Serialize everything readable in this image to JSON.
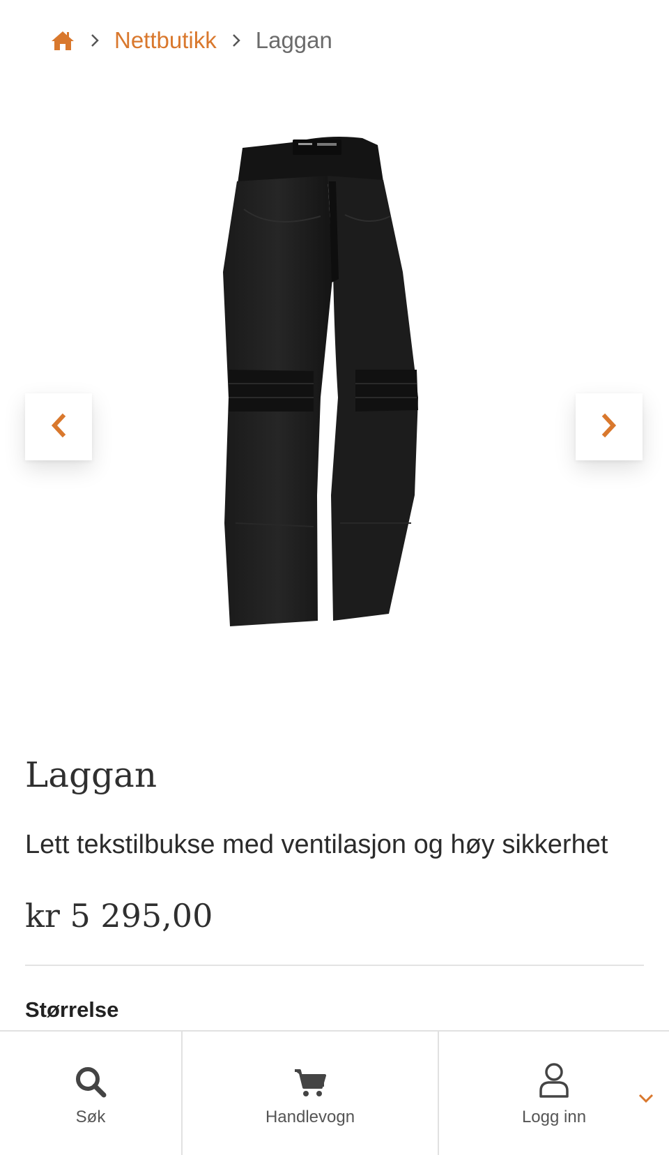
{
  "breadcrumb": {
    "home_icon": "home-icon",
    "items": [
      "Nettbutikk",
      "Laggan"
    ]
  },
  "gallery": {
    "prev_icon": "chevron-left-icon",
    "next_icon": "chevron-right-icon"
  },
  "product": {
    "title": "Laggan",
    "description": "Lett tekstilbukse med ventilasjon og høy sikkerhet",
    "price": "kr 5 295,00",
    "size_label": "Størrelse"
  },
  "bottom_bar": {
    "search_label": "Søk",
    "cart_label": "Handlevogn",
    "login_label": "Logg inn"
  },
  "colors": {
    "accent": "#d9782d",
    "text": "#2b2b2b",
    "muted": "#6b6b6b"
  }
}
